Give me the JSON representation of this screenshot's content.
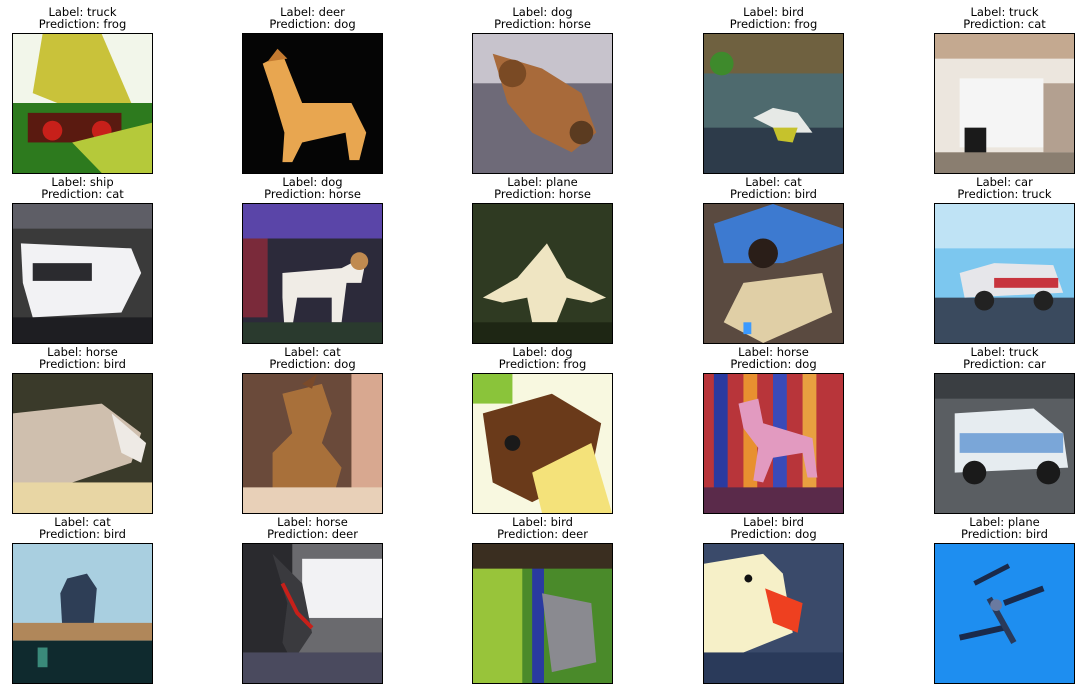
{
  "grid": [
    {
      "label": "Label: truck",
      "prediction": "Prediction: frog",
      "subject": "truck-photo"
    },
    {
      "label": "Label: deer",
      "prediction": "Prediction: dog",
      "subject": "deer-photo"
    },
    {
      "label": "Label: dog",
      "prediction": "Prediction: horse",
      "subject": "dog-photo"
    },
    {
      "label": "Label: bird",
      "prediction": "Prediction: frog",
      "subject": "bird-photo"
    },
    {
      "label": "Label: truck",
      "prediction": "Prediction: cat",
      "subject": "truck-photo"
    },
    {
      "label": "Label: ship",
      "prediction": "Prediction: cat",
      "subject": "ship-photo"
    },
    {
      "label": "Label: dog",
      "prediction": "Prediction: horse",
      "subject": "dog-photo"
    },
    {
      "label": "Label: plane",
      "prediction": "Prediction: horse",
      "subject": "plane-photo"
    },
    {
      "label": "Label: cat",
      "prediction": "Prediction: bird",
      "subject": "cat-photo"
    },
    {
      "label": "Label: car",
      "prediction": "Prediction: truck",
      "subject": "car-photo"
    },
    {
      "label": "Label: horse",
      "prediction": "Prediction: bird",
      "subject": "horse-photo"
    },
    {
      "label": "Label: cat",
      "prediction": "Prediction: dog",
      "subject": "cat-photo"
    },
    {
      "label": "Label: dog",
      "prediction": "Prediction: frog",
      "subject": "dog-photo"
    },
    {
      "label": "Label: horse",
      "prediction": "Prediction: dog",
      "subject": "horse-photo"
    },
    {
      "label": "Label: truck",
      "prediction": "Prediction: car",
      "subject": "truck-photo"
    },
    {
      "label": "Label: cat",
      "prediction": "Prediction: bird",
      "subject": "cat-photo"
    },
    {
      "label": "Label: horse",
      "prediction": "Prediction: deer",
      "subject": "horse-photo"
    },
    {
      "label": "Label: bird",
      "prediction": "Prediction: deer",
      "subject": "bird-photo"
    },
    {
      "label": "Label: bird",
      "prediction": "Prediction: dog",
      "subject": "bird-photo"
    },
    {
      "label": "Label: plane",
      "prediction": "Prediction: bird",
      "subject": "plane-photo"
    }
  ]
}
